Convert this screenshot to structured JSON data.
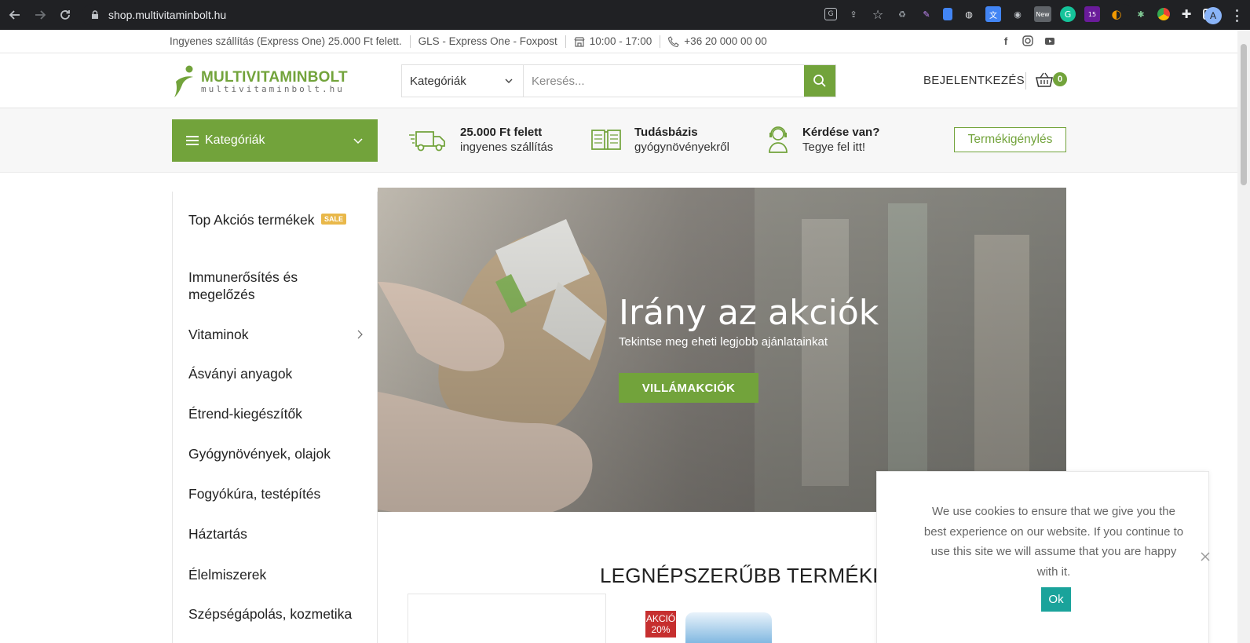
{
  "browser": {
    "url": "shop.multivitaminbolt.hu",
    "ext_badges": {
      "new": "New",
      "count": "15"
    },
    "profile_initial": "A"
  },
  "topbar": {
    "shipping": "Ingyenes szállítás (Express One) 25.000 Ft felett.",
    "carriers": "GLS - Express One - Foxpost",
    "hours": "10:00 - 17:00",
    "phone": "+36 20 000 00 00"
  },
  "header": {
    "logo_name_part1": "MULTIVITAMIN",
    "logo_name_part2": "BOLT",
    "logo_sub": "multivitaminbolt.hu",
    "search_category": "Kategóriák",
    "search_placeholder": "Keresés...",
    "login": "BEJELENTKEZÉS",
    "cart_count": "0"
  },
  "strip": {
    "categories_toggle": "Kategóriák",
    "features": [
      {
        "title": "25.000 Ft felett",
        "sub": "ingyenes szállítás",
        "icon": "truck-icon"
      },
      {
        "title": "Tudásbázis",
        "sub": "gyógynövényekről",
        "icon": "book-icon"
      },
      {
        "title": "Kérdése van?",
        "sub": "Tegye fel itt!",
        "icon": "support-agent-icon"
      }
    ],
    "request_button": "Termékigénylés"
  },
  "sidemenu": {
    "sale_badge": "SALE",
    "items": [
      {
        "label": "Top Akciós termékek"
      },
      {
        "label": "Immunerősítés és megelőzés"
      },
      {
        "label": "Vitaminok"
      },
      {
        "label": "Ásványi anyagok"
      },
      {
        "label": "Étrend-kiegészítők"
      },
      {
        "label": "Gyógynövények, olajok"
      },
      {
        "label": "Fogyókúra, testépítés"
      },
      {
        "label": "Háztartás"
      },
      {
        "label": "Élelmiszerek"
      },
      {
        "label": "Szépségápolás, kozmetika"
      }
    ]
  },
  "hero": {
    "title": "Irány az akciók",
    "subtitle": "Tekintse meg eheti legjobb ajánlatainkat",
    "cta": "VILLÁMAKCIÓK"
  },
  "products": {
    "section_title": "LEGNÉPSZERŰBB TERMÉKEK",
    "badge_line1": "AKCIÓ",
    "badge_line2": "20%"
  },
  "cookie": {
    "message": "We use cookies to ensure that we give you the best experience on our website. If you continue to use this site we will assume that you are happy with it.",
    "ok": "Ok"
  },
  "colors": {
    "brand_green": "#72a33b",
    "cookie_ok": "#1aa39b",
    "sale_badge": "#e9b84a",
    "akcio_badge": "#c62f2f"
  }
}
